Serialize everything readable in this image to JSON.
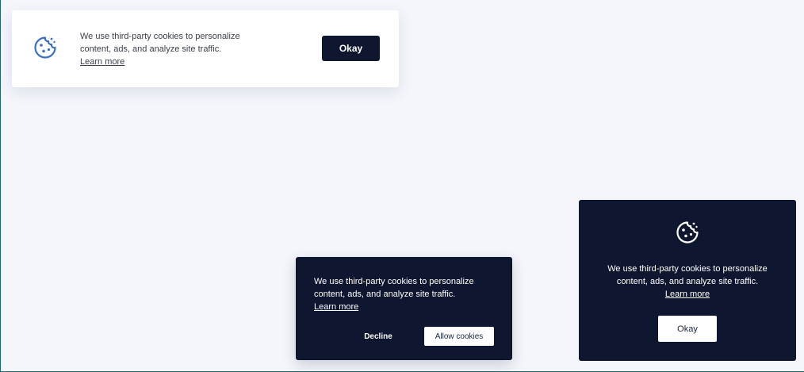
{
  "banner_top": {
    "icon": "cookie-icon",
    "icon_color": "#3b6fc4",
    "message": "We use third-party cookies to personalize content, ads, and analyze site traffic.",
    "learn_more": "Learn more",
    "okay_label": "Okay"
  },
  "banner_bottom": {
    "message": "We use third-party cookies to personalize content, ads, and analyze site traffic.",
    "learn_more": "Learn more",
    "decline_label": "Decline",
    "allow_label": "Allow cookies"
  },
  "banner_right": {
    "icon": "cookie-icon",
    "icon_color": "#ffffff",
    "message": "We use third-party cookies to personalize content, ads, and analyze site traffic.",
    "learn_more": "Learn more",
    "okay_label": "Okay"
  },
  "colors": {
    "page_background": "#f4f6fb",
    "dark_navy": "#0f1730",
    "white": "#ffffff"
  }
}
